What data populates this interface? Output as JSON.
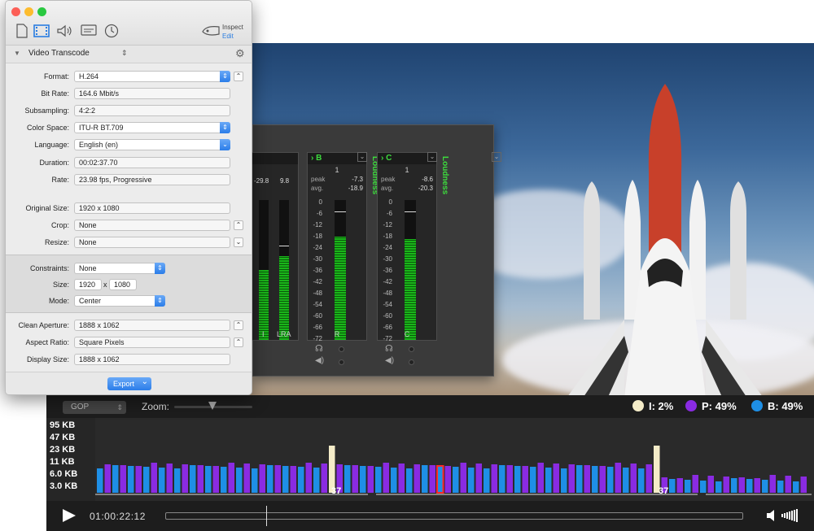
{
  "inspector": {
    "inspect_label": "Inspect",
    "edit_label": "Edit",
    "section_title": "Video Transcode",
    "rows": {
      "format": {
        "label": "Format:",
        "value": "H.264"
      },
      "bit_rate": {
        "label": "Bit Rate:",
        "value": "164.6 Mbit/s"
      },
      "subsampling": {
        "label": "Subsampling:",
        "value": "4:2:2"
      },
      "color_space": {
        "label": "Color Space:",
        "value": "ITU-R BT.709"
      },
      "language": {
        "label": "Language:",
        "value": "English (en)"
      },
      "duration": {
        "label": "Duration:",
        "value": "00:02:37.70"
      },
      "rate": {
        "label": "Rate:",
        "value": "23.98 fps, Progressive"
      },
      "original_size": {
        "label": "Original Size:",
        "value": "1920 x 1080"
      },
      "crop": {
        "label": "Crop:",
        "value": "None"
      },
      "resize": {
        "label": "Resize:",
        "value": "None"
      },
      "constraints": {
        "label": "Constraints:",
        "value": "None"
      },
      "size": {
        "label": "Size:",
        "width": "1920",
        "x": "x",
        "height": "1080"
      },
      "mode": {
        "label": "Mode:",
        "value": "Center"
      },
      "clean_aperture": {
        "label": "Clean Aperture:",
        "value": "1888 x 1062"
      },
      "aspect_ratio": {
        "label": "Aspect Ratio:",
        "value": "Square Pixels"
      },
      "display_size": {
        "label": "Display Size:",
        "value": "1888 x 1062"
      }
    },
    "export_label": "Export"
  },
  "meter": {
    "loudness_label": "Loudness",
    "partial": {
      "values": [
        "-29.8",
        "9.8"
      ],
      "labels": [
        "I",
        "LRA"
      ]
    },
    "channels": [
      {
        "name": "B",
        "num": "1",
        "peak_label": "peak",
        "peak": "-7.3",
        "avg_label": "avg.",
        "avg": "-18.9",
        "foot": "R",
        "level": 0.74
      },
      {
        "name": "C",
        "num": "1",
        "peak_label": "peak",
        "peak": "-8.6",
        "avg_label": "avg.",
        "avg": "-20.3",
        "foot": "C",
        "level": 0.72
      }
    ],
    "scale": [
      "0",
      "-6",
      "-12",
      "-18",
      "-24",
      "-30",
      "-36",
      "-42",
      "-48",
      "-54",
      "-60",
      "-66",
      "-72"
    ]
  },
  "stats": {
    "gop_select": "GOP",
    "zoom_label": "Zoom:",
    "legend": [
      {
        "text": "I: 2%",
        "color": "#f4ecc8"
      },
      {
        "text": "P: 49%",
        "color": "#8a2be2"
      },
      {
        "text": "B: 49%",
        "color": "#1e8fe6"
      }
    ]
  },
  "graph": {
    "y_labels": [
      "95 KB",
      "47 KB",
      "23 KB",
      "11 KB",
      "6.0 KB",
      "3.0 KB"
    ],
    "gop_labels": [
      "37",
      "37"
    ],
    "colors": {
      "I": "#f4ecc8",
      "P": "#8a2be2",
      "B": "#1e8fe6",
      "selected": "#ff2a2a"
    }
  },
  "transport": {
    "timecode": "01:00:22:12"
  }
}
